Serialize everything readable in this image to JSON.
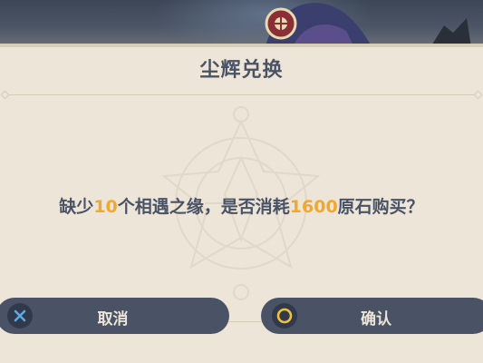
{
  "dialog": {
    "title": "尘辉兑换",
    "message": {
      "part1": "缺少",
      "missing_count": "10",
      "part2": "个相遇之缘，是否消耗",
      "primogem_cost": "1600",
      "part3": "原石购买？"
    }
  },
  "buttons": {
    "cancel_label": "取消",
    "confirm_label": "确认"
  },
  "colors": {
    "dialog_bg": "#ece5d8",
    "text": "#4a5366",
    "highlight": "#f0a830",
    "button_bg": "#4a5366",
    "button_text": "#ece5d8"
  }
}
